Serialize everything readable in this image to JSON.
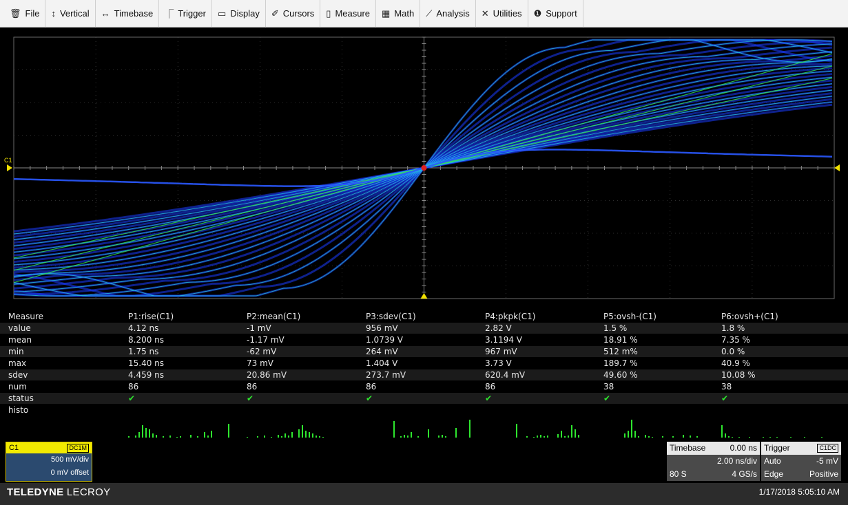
{
  "menu": [
    {
      "icon": "trash-icon",
      "glyph": "🗑",
      "label": "File"
    },
    {
      "icon": "vertical-arrows-icon",
      "glyph": "↕",
      "label": "Vertical"
    },
    {
      "icon": "horizontal-arrows-icon",
      "glyph": "↔",
      "label": "Timebase"
    },
    {
      "icon": "trigger-icon",
      "glyph": "⎾",
      "label": "Trigger"
    },
    {
      "icon": "display-icon",
      "glyph": "▭",
      "label": "Display"
    },
    {
      "icon": "cursor-icon",
      "glyph": "✐",
      "label": "Cursors"
    },
    {
      "icon": "measure-icon",
      "glyph": "▯",
      "label": "Measure"
    },
    {
      "icon": "calculator-icon",
      "glyph": "▦",
      "label": "Math"
    },
    {
      "icon": "analysis-chart-icon",
      "glyph": "⟋",
      "label": "Analysis"
    },
    {
      "icon": "tools-icon",
      "glyph": "✕",
      "label": "Utilities"
    },
    {
      "icon": "info-icon",
      "glyph": "❶",
      "label": "Support"
    }
  ],
  "scope": {
    "channel_marker": "C1",
    "colors": {
      "grid": "#5a5a5a",
      "trace_blue": "#1a3cff",
      "trace_cyan": "#27c9d8",
      "trace_green": "#32e64a",
      "marker": "#f0e000"
    }
  },
  "measure": {
    "row_labels": [
      "Measure",
      "value",
      "mean",
      "min",
      "max",
      "sdev",
      "num",
      "status",
      "histo"
    ],
    "params": [
      {
        "name": "P1:rise(C1)",
        "value": "4.12 ns",
        "mean": "8.200 ns",
        "min": "1.75 ns",
        "max": "15.40 ns",
        "sdev": "4.459 ns",
        "num": "86",
        "status": "✔"
      },
      {
        "name": "P2:mean(C1)",
        "value": "-1 mV",
        "mean": "-1.17 mV",
        "min": "-62 mV",
        "max": "73 mV",
        "sdev": "20.86 mV",
        "num": "86",
        "status": "✔"
      },
      {
        "name": "P3:sdev(C1)",
        "value": "956 mV",
        "mean": "1.0739 V",
        "min": "264 mV",
        "max": "1.404 V",
        "sdev": "273.7 mV",
        "num": "86",
        "status": "✔"
      },
      {
        "name": "P4:pkpk(C1)",
        "value": "2.82 V",
        "mean": "3.1194 V",
        "min": "967 mV",
        "max": "3.73 V",
        "sdev": "620.4 mV",
        "num": "86",
        "status": "✔"
      },
      {
        "name": "P5:ovsh-(C1)",
        "value": "1.5 %",
        "mean": "18.91 %",
        "min": "512 m%",
        "max": "189.7 %",
        "sdev": "49.60 %",
        "num": "38",
        "status": "✔"
      },
      {
        "name": "P6:ovsh+(C1)",
        "value": "1.8 %",
        "mean": "7.35 %",
        "min": "0.0 %",
        "max": "40.9 %",
        "sdev": "10.08 %",
        "num": "38",
        "status": "✔"
      }
    ]
  },
  "channel": {
    "name": "C1",
    "coupling": "DC1M",
    "scale": "500 mV/div",
    "offset": "0 mV offset"
  },
  "timebase": {
    "label": "Timebase",
    "delay": "0.00 ns",
    "scale": "2.00 ns/div",
    "samples": "80 S",
    "rate": "4 GS/s"
  },
  "trigger": {
    "label": "Trigger",
    "source": "C1",
    "coupling": "DC",
    "mode": "Auto",
    "level": "-5 mV",
    "type": "Edge",
    "slope": "Positive"
  },
  "footer": {
    "brand_bold": "TELEDYNE",
    "brand_thin": "LECROY",
    "datetime": "1/17/2018 5:05:10 AM"
  }
}
